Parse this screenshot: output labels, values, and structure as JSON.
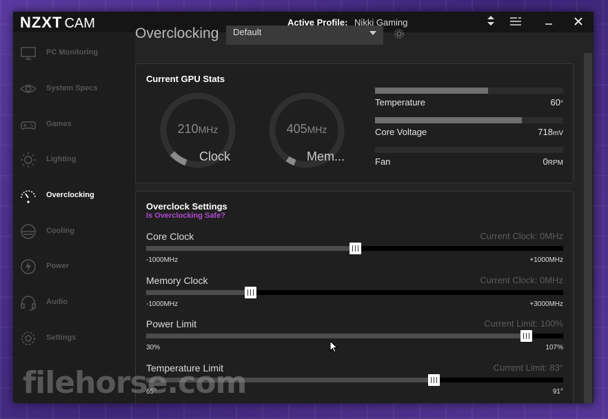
{
  "app": {
    "brand_bold": "NZXT",
    "brand_light": "CAM"
  },
  "titlebar": {
    "profile_label": "Active Profile:",
    "profile_value": "Nikki Gaming",
    "icons": [
      "sort-icon",
      "menu-icon",
      "minimize-icon",
      "close-icon"
    ]
  },
  "sidebar": {
    "items": [
      {
        "label": "PC Monitoring",
        "icon": "monitor-icon",
        "active": false
      },
      {
        "label": "System Specs",
        "icon": "eye-icon",
        "active": false
      },
      {
        "label": "Games",
        "icon": "gamepad-icon",
        "active": false
      },
      {
        "label": "Lighting",
        "icon": "sun-icon",
        "active": false
      },
      {
        "label": "Overclocking",
        "icon": "speedometer-icon",
        "active": true
      },
      {
        "label": "Cooling",
        "icon": "fan-icon",
        "active": false
      },
      {
        "label": "Power",
        "icon": "lightning-icon",
        "active": false
      },
      {
        "label": "Audio",
        "icon": "headset-icon",
        "active": false
      },
      {
        "label": "Settings",
        "icon": "gear-icon",
        "active": false
      }
    ]
  },
  "main": {
    "title": "Overclocking",
    "preset": "Default",
    "gpu_stats": {
      "title": "Current GPU Stats",
      "gauges": [
        {
          "value": "210",
          "unit": "MHz",
          "label": "Clock",
          "level": 0.1
        },
        {
          "value": "405",
          "unit": "MHz",
          "label": "Mem...",
          "level": 0.05
        }
      ],
      "stats": [
        {
          "name": "Temperature",
          "value": "60",
          "unit": "°",
          "level": 0.6
        },
        {
          "name": "Core Voltage",
          "value": "718",
          "unit": "mV",
          "level": 0.78
        },
        {
          "name": "Fan",
          "value": "0",
          "unit": "RPM",
          "level": 0.0
        }
      ]
    },
    "oc_settings": {
      "title": "Overclock Settings",
      "safe_link": "Is Overclocking Safe?",
      "sliders": [
        {
          "name": "Core Clock",
          "current": "Current Clock: 0MHz",
          "min": "-1000MHz",
          "max": "+1000MHz",
          "level": 0.5
        },
        {
          "name": "Memory Clock",
          "current": "Current Clock: 0MHz",
          "min": "-1000MHz",
          "max": "+3000MHz",
          "level": 0.25
        },
        {
          "name": "Power Limit",
          "current": "Current Limit: 100%",
          "min": "30%",
          "max": "107%",
          "level": 0.91
        },
        {
          "name": "Temperature Limit",
          "current": "Current Limit: 83°",
          "min": "65°",
          "max": "91°",
          "level": 0.69
        }
      ]
    }
  },
  "watermark": "filehorse.com",
  "colors": {
    "accent_purple": "#b04ad2",
    "background": "#242424",
    "sidebar": "#1d1d1d"
  }
}
